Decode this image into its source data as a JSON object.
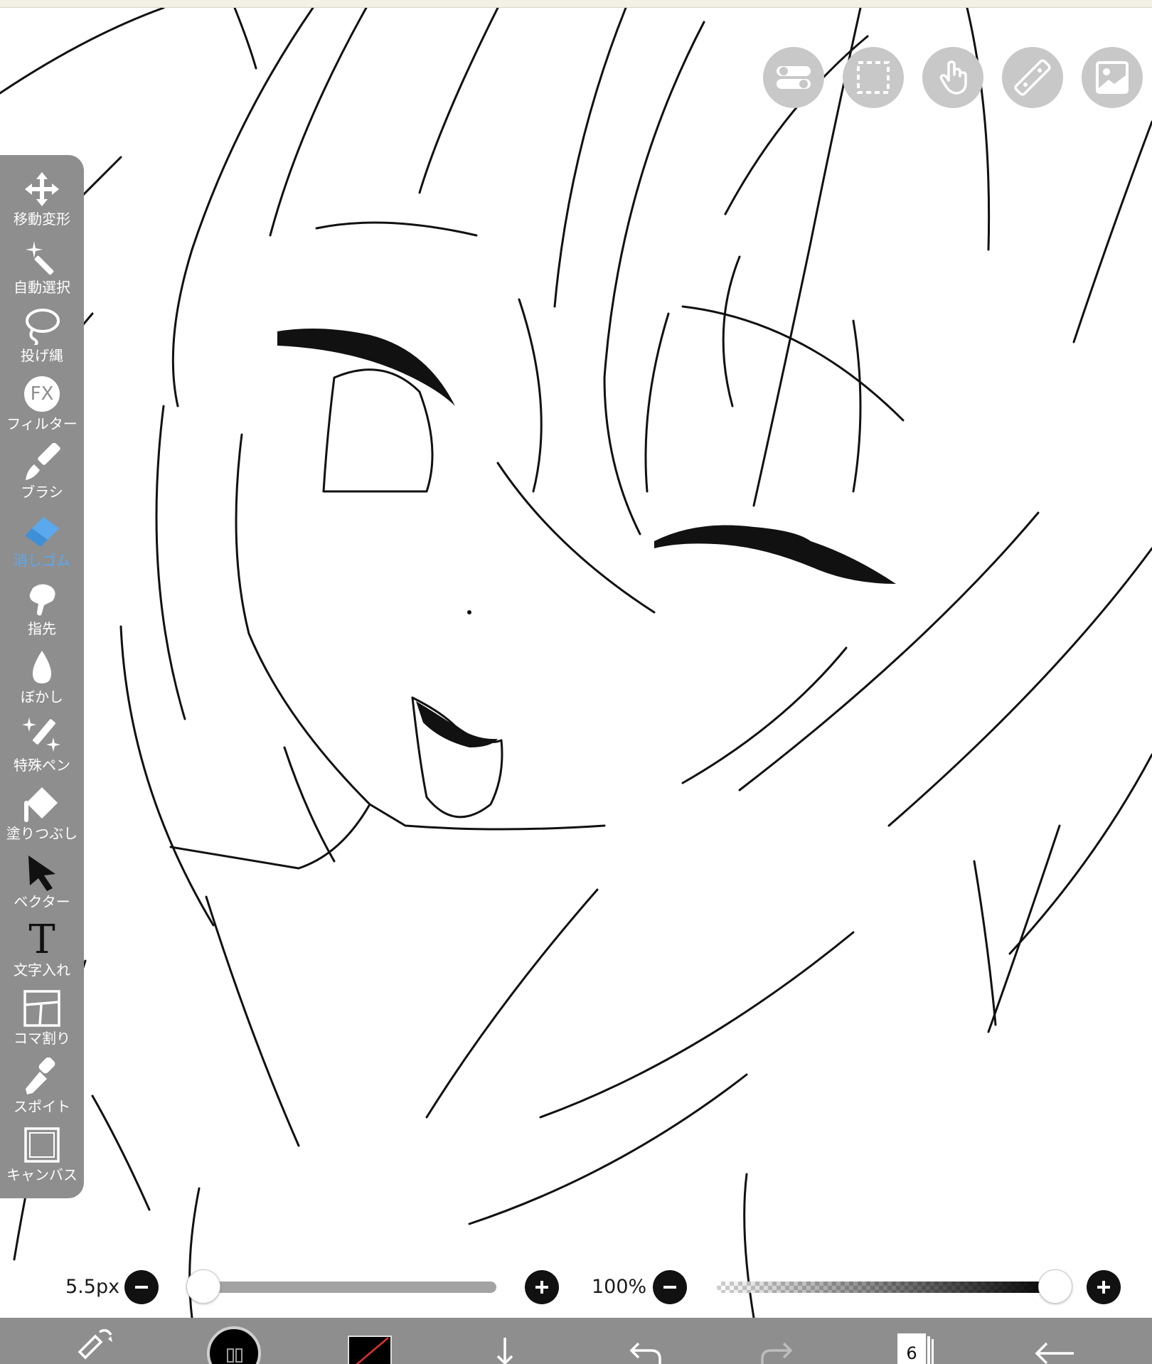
{
  "top_buttons": [
    {
      "name": "toggle-icon"
    },
    {
      "name": "selection-marquee-icon"
    },
    {
      "name": "hand-gesture-icon"
    },
    {
      "name": "ruler-icon"
    },
    {
      "name": "image-icon"
    }
  ],
  "toolbar": {
    "active_color": "#5aa9ee",
    "items": [
      {
        "label": "移動変形",
        "icon": "move-icon"
      },
      {
        "label": "自動選択",
        "icon": "magic-wand-icon"
      },
      {
        "label": "投げ縄",
        "icon": "lasso-icon"
      },
      {
        "label": "フィルター",
        "icon": "fx-icon",
        "icon_text": "FX"
      },
      {
        "label": "ブラシ",
        "icon": "brush-icon"
      },
      {
        "label": "消しゴム",
        "icon": "eraser-icon",
        "active": true
      },
      {
        "label": "指先",
        "icon": "finger-icon"
      },
      {
        "label": "ぼかし",
        "icon": "blur-drop-icon"
      },
      {
        "label": "特殊ペン",
        "icon": "special-pen-icon"
      },
      {
        "label": "塗りつぶし",
        "icon": "fill-bucket-icon"
      },
      {
        "label": "ベクター",
        "icon": "vector-arrow-icon"
      },
      {
        "label": "文字入れ",
        "icon": "text-icon",
        "icon_text": "T"
      },
      {
        "label": "コマ割り",
        "icon": "panel-frame-icon"
      },
      {
        "label": "スポイト",
        "icon": "eyedropper-icon"
      },
      {
        "label": "キャンバス",
        "icon": "canvas-icon"
      }
    ]
  },
  "brush_size": {
    "value_text": "5.5px",
    "fraction": 0.01
  },
  "opacity": {
    "value_text": "100%",
    "fraction": 1.0
  },
  "bottom_bar": {
    "layer_count": "6",
    "icons": [
      "brush-settings-icon",
      "brush-preview-icon",
      "color-swatch-icon",
      "import-arrow-icon",
      "undo-icon",
      "redo-icon",
      "layers-icon",
      "back-arrow-icon"
    ]
  }
}
